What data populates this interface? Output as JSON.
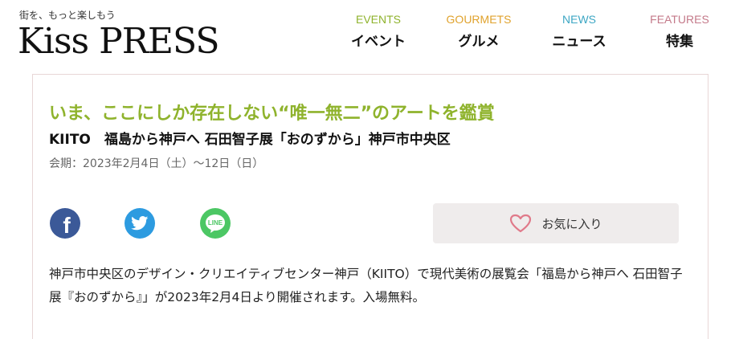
{
  "header": {
    "tagline": "街を、もっと楽しもう",
    "logo": "Kiss PRESS",
    "nav": [
      {
        "en": "EVENTS",
        "ja": "イベント",
        "color": "#8fb32d"
      },
      {
        "en": "GOURMETS",
        "ja": "グルメ",
        "color": "#e0a22c"
      },
      {
        "en": "NEWS",
        "ja": "ニュース",
        "color": "#3ea7c4"
      },
      {
        "en": "FEATURES",
        "ja": "特集",
        "color": "#c47a8a"
      }
    ]
  },
  "article": {
    "headline": "いま、ここにしか存在しない“唯一無二”のアートを鑑賞",
    "subhead": "KIITO　福島から神戸へ 石田智子展「おのずから」神戸市中央区",
    "period": "会期：2023年2月4日（土）〜12日（日）",
    "favorite_label": "お気に入り",
    "body": "神戸市中央区のデザイン・クリエイティブセンター神戸（KIITO）で現代美術の展覧会「福島から神戸へ 石田智子展『おのずから』」が2023年2月4日より開催されます。入場無料。"
  },
  "social": [
    {
      "name": "facebook",
      "color": "#3b5998"
    },
    {
      "name": "twitter",
      "color": "#2d9be0"
    },
    {
      "name": "line",
      "color": "#4cc764",
      "label": "LINE"
    }
  ]
}
